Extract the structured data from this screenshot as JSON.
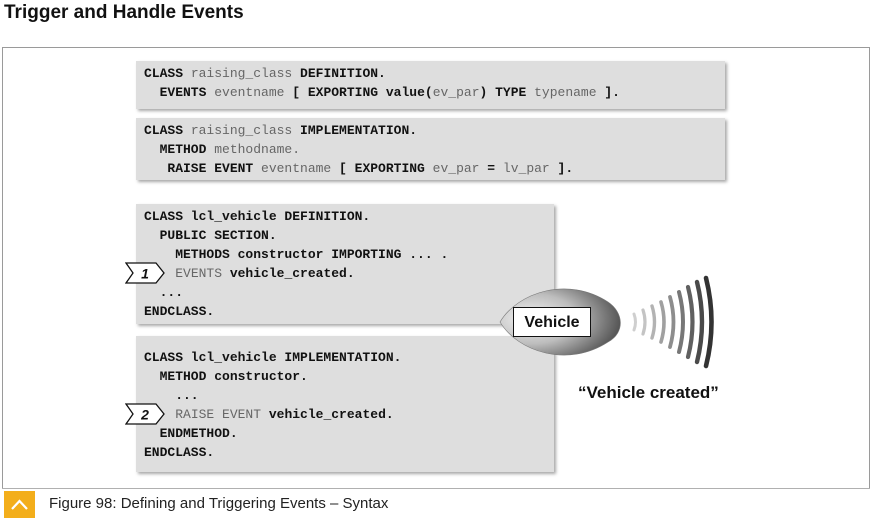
{
  "title": "Trigger and Handle Events",
  "code_blocks": [
    {
      "lines": [
        [
          "CLASS",
          " raising_class ",
          "DEFINITION."
        ],
        [
          "  EVENTS",
          " eventname ",
          "[ EXPORTING value(",
          "ev_par",
          ") TYPE",
          " typename ",
          "]."
        ]
      ]
    },
    {
      "lines": [
        [
          "CLASS",
          " raising_class ",
          "IMPLEMENTATION."
        ],
        [
          "  METHOD",
          " methodname."
        ],
        [
          "   RAISE EVENT",
          " eventname ",
          "[ EXPORTING",
          " ev_par ",
          "=",
          " lv_par ",
          "]."
        ]
      ]
    },
    {
      "lines": [
        [
          "CLASS lcl_vehicle DEFINITION."
        ],
        [
          "  PUBLIC SECTION."
        ],
        [
          "    METHODS constructor IMPORTING ... ."
        ],
        [
          "    ",
          "EVENTS",
          " vehicle_created."
        ],
        [
          "  ..."
        ],
        [
          "ENDCLASS."
        ]
      ]
    },
    {
      "lines": [
        [
          "CLASS lcl_vehicle IMPLEMENTATION."
        ],
        [
          "  METHOD constructor."
        ],
        [
          "    ..."
        ],
        [
          "    ",
          "RAISE EVENT",
          " vehicle_created."
        ],
        [
          "  ENDMETHOD."
        ],
        [
          "ENDCLASS."
        ]
      ]
    }
  ],
  "markers": [
    "1",
    "2"
  ],
  "vehicle_label": "Vehicle",
  "vehicle_caption": "“Vehicle created”",
  "figure_caption": "Figure 98: Defining and Triggering Events – Syntax",
  "accent_color": "#f3ae1b"
}
